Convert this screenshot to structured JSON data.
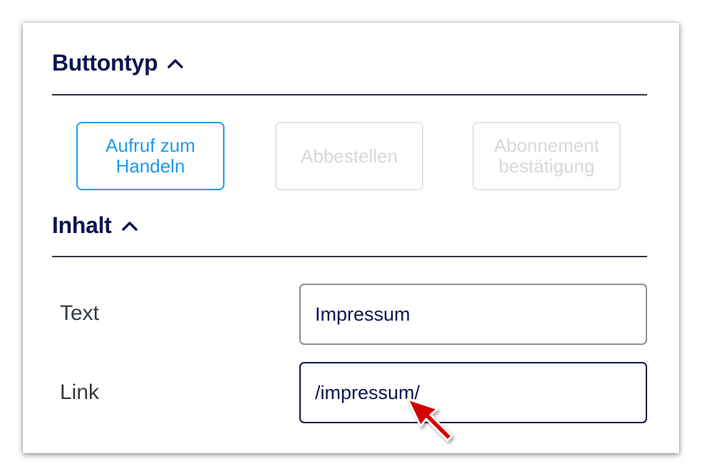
{
  "sections": {
    "button_type": {
      "title": "Buttontyp"
    },
    "content": {
      "title": "Inhalt"
    }
  },
  "button_types": [
    {
      "line1": "Aufruf zum",
      "line2": "Handeln",
      "state": "selected"
    },
    {
      "line1": "Abbestellen",
      "line2": "",
      "state": "disabled"
    },
    {
      "line1": "Abonnement",
      "line2": "bestätigung",
      "state": "disabled"
    }
  ],
  "fields": {
    "text": {
      "label": "Text",
      "value": "Impressum"
    },
    "link": {
      "label": "Link",
      "value": "/impressum/"
    }
  },
  "icons": {
    "collapse": "chevron-up-icon",
    "pointer": "red-arrow-pointer-icon"
  },
  "colors": {
    "heading": "#0d1450",
    "accent": "#1e9be9",
    "disabled": "#d8d8d8",
    "pointer": "#d40000"
  }
}
